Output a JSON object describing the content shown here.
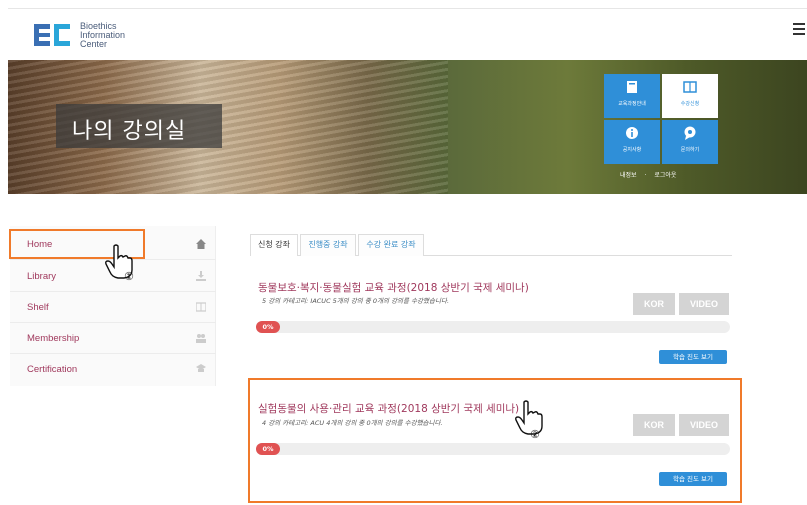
{
  "header": {
    "logo_line1": "Bioethics",
    "logo_line2": "Information",
    "logo_line3": "Center",
    "menu_icon": "hamburger-icon"
  },
  "banner": {
    "title": "나의 강의실",
    "tiles": [
      {
        "label": "교육과정안내",
        "icon": "book-icon"
      },
      {
        "label": "수강신청",
        "icon": "notebook-icon"
      },
      {
        "label": "공지사항",
        "icon": "info-icon"
      },
      {
        "label": "문의하기",
        "icon": "chat-icon"
      }
    ],
    "links": [
      "내정보",
      "로그아웃"
    ]
  },
  "sidebar": {
    "items": [
      {
        "label": "Home",
        "icon": "home-icon"
      },
      {
        "label": "Library",
        "icon": "download-icon"
      },
      {
        "label": "Shelf",
        "icon": "book-icon"
      },
      {
        "label": "Membership",
        "icon": "users-icon"
      },
      {
        "label": "Certification",
        "icon": "certificate-icon"
      }
    ]
  },
  "tabs": [
    {
      "label": "신청 강좌",
      "active": true
    },
    {
      "label": "진행중 강좌",
      "active": false
    },
    {
      "label": "수강 완료 강좌",
      "active": false
    }
  ],
  "courses": [
    {
      "title": "동물보호·복지·동물실험 교육 과정(2018 상반기 국제 세미나)",
      "subtitle": "5 강의   카테고리: IACUC   5개의 강의 중 0개의 강의를 수강했습니다.",
      "kor_label": "KOR",
      "video_label": "VIDEO",
      "progress_label": "0%",
      "progress": 0,
      "progress_button": "학습 진도 보기"
    },
    {
      "title": "실험동물의 사용·관리 교육 과정(2018 상반기 국제 세미나)",
      "subtitle": "4 강의   카테고리: ACU   4개의 강의 중 0개의 강의를 수강했습니다.",
      "kor_label": "KOR",
      "video_label": "VIDEO",
      "progress_label": "0%",
      "progress": 0,
      "progress_button": "학습 진도 보기"
    }
  ],
  "annotations": {
    "step1": "①",
    "step2": "②"
  },
  "colors": {
    "accent": "#a0395d",
    "highlight": "#f07a2a",
    "blue": "#2f8fd8",
    "progress_badge": "#e05252"
  }
}
